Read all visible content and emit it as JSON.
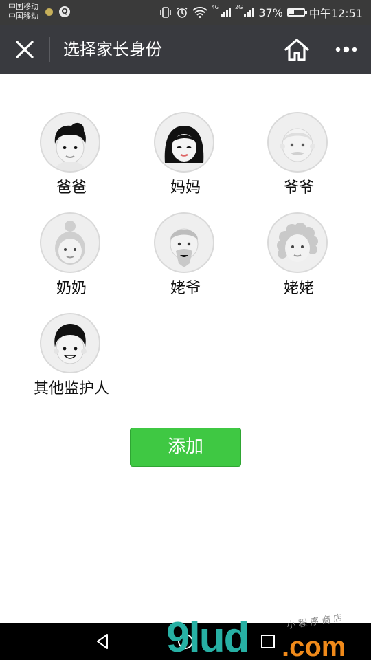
{
  "status_bar": {
    "carrier_1": "中国移动",
    "carrier_2": "中国移动",
    "net_tag_1": "4G",
    "net_tag_2": "2G",
    "battery_percent_text": "37%",
    "battery_level": 0.37,
    "time": "中午12:51"
  },
  "nav": {
    "title": "选择家长身份",
    "close_icon": "close-icon",
    "home_icon": "home-icon",
    "more_icon": "more-icon"
  },
  "identities": [
    {
      "label": "爸爸",
      "avatar": "father"
    },
    {
      "label": "妈妈",
      "avatar": "mother"
    },
    {
      "label": "爷爷",
      "avatar": "grandfather-paternal"
    },
    {
      "label": "奶奶",
      "avatar": "grandmother-paternal"
    },
    {
      "label": "姥爷",
      "avatar": "grandfather-maternal"
    },
    {
      "label": "姥姥",
      "avatar": "grandmother-maternal"
    },
    {
      "label": "其他监护人",
      "avatar": "other-guardian"
    }
  ],
  "add_button": "添加",
  "watermark": {
    "logo": "9lud.com",
    "caption": "小程序商店"
  },
  "colors": {
    "status_bar": "#3a3a3a",
    "nav_bar": "#393a3f",
    "accent_green": "#3fc843",
    "avatar_bg": "#efefef"
  }
}
